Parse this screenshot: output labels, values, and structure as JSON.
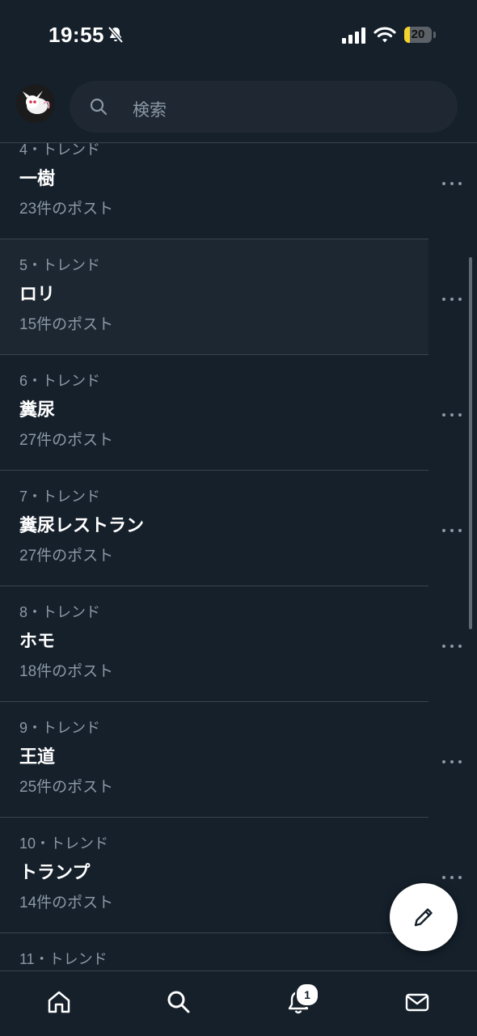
{
  "status_bar": {
    "time": "19:55",
    "battery": "20",
    "battery_level": 0.2
  },
  "header": {
    "search_placeholder": "検索"
  },
  "trends": [
    {
      "meta": "4・トレンド",
      "title": "一樹",
      "count": "23件のポスト"
    },
    {
      "meta": "5・トレンド",
      "title": "ロリ",
      "count": "15件のポスト"
    },
    {
      "meta": "6・トレンド",
      "title": "糞尿",
      "count": "27件のポスト"
    },
    {
      "meta": "7・トレンド",
      "title": "糞尿レストラン",
      "count": "27件のポスト"
    },
    {
      "meta": "8・トレンド",
      "title": "ホモ",
      "count": "18件のポスト"
    },
    {
      "meta": "9・トレンド",
      "title": "王道",
      "count": "25件のポスト"
    },
    {
      "meta": "10・トレンド",
      "title": "トランプ",
      "count": "14件のポスト"
    },
    {
      "meta": "11・トレンド",
      "title": "",
      "count": ""
    }
  ],
  "nav": {
    "notifications_badge": "1"
  },
  "colors": {
    "background": "#15202b",
    "highlight": "#1c2732",
    "secondary_text": "#8b98a5",
    "divider": "#38444d"
  }
}
